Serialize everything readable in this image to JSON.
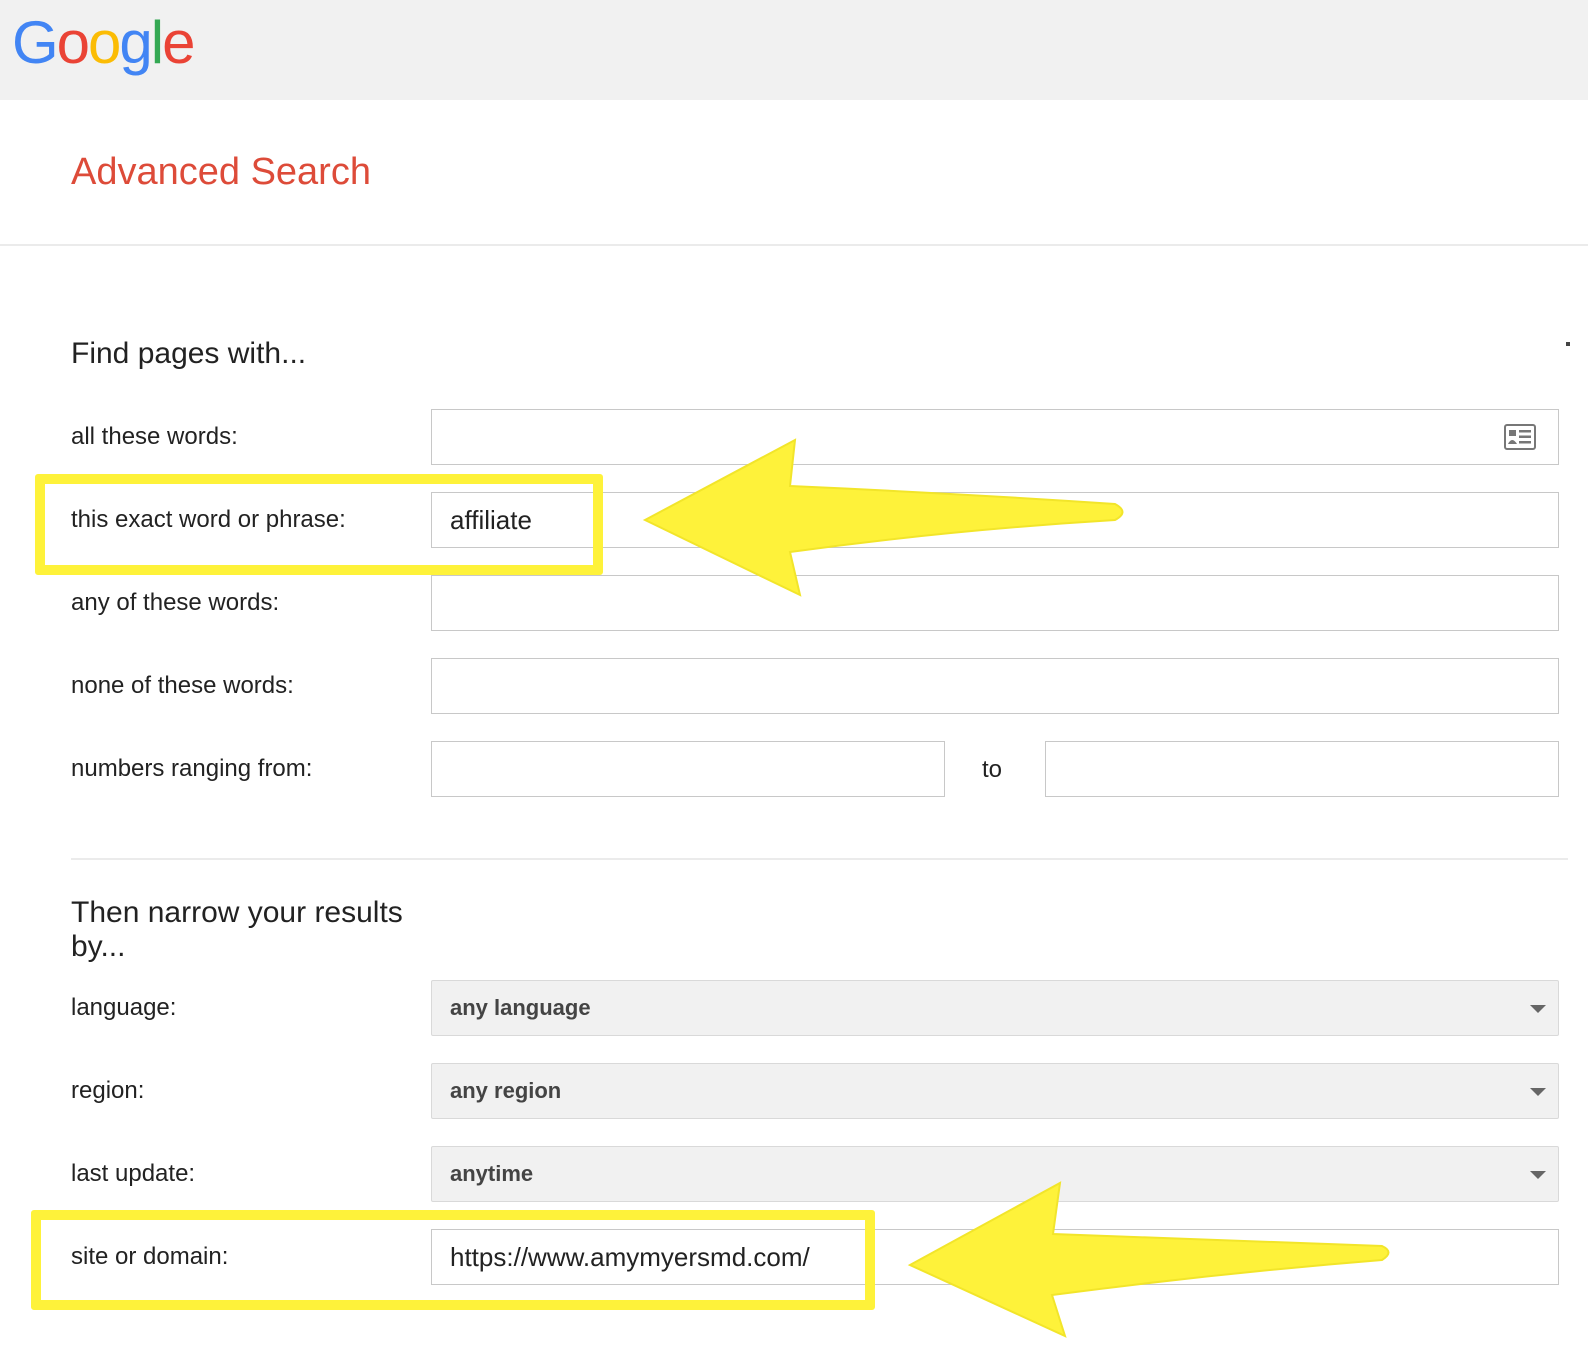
{
  "header": {
    "logo_letters": [
      {
        "char": "G",
        "color": "#4285f4"
      },
      {
        "char": "o",
        "color": "#ea4335"
      },
      {
        "char": "o",
        "color": "#fbbc05"
      },
      {
        "char": "g",
        "color": "#4285f4"
      },
      {
        "char": "l",
        "color": "#34a853"
      },
      {
        "char": "e",
        "color": "#ea4335"
      }
    ]
  },
  "page": {
    "title": "Advanced Search",
    "title_color": "#dd4b39"
  },
  "find_section": {
    "heading": "Find pages with...",
    "all_words": {
      "label": "all these words:",
      "value": "",
      "icon": "keyboard-icon"
    },
    "exact_phrase": {
      "label": "this exact word or phrase:",
      "value": "affiliate"
    },
    "any_words": {
      "label": "any of these words:",
      "value": ""
    },
    "none_words": {
      "label": "none of these words:",
      "value": ""
    },
    "numbers_range": {
      "label": "numbers ranging from:",
      "from_value": "",
      "to_label": "to",
      "to_value": ""
    }
  },
  "narrow_section": {
    "heading": "Then narrow your results by...",
    "language": {
      "label": "language:",
      "selected": "any language"
    },
    "region": {
      "label": "region:",
      "selected": "any region"
    },
    "last_update": {
      "label": "last update:",
      "selected": "anytime"
    },
    "site_domain": {
      "label": "site or domain:",
      "value": "https://www.amymyersmd.com/"
    }
  },
  "annotations": {
    "highlight_color": "#fef23a"
  }
}
